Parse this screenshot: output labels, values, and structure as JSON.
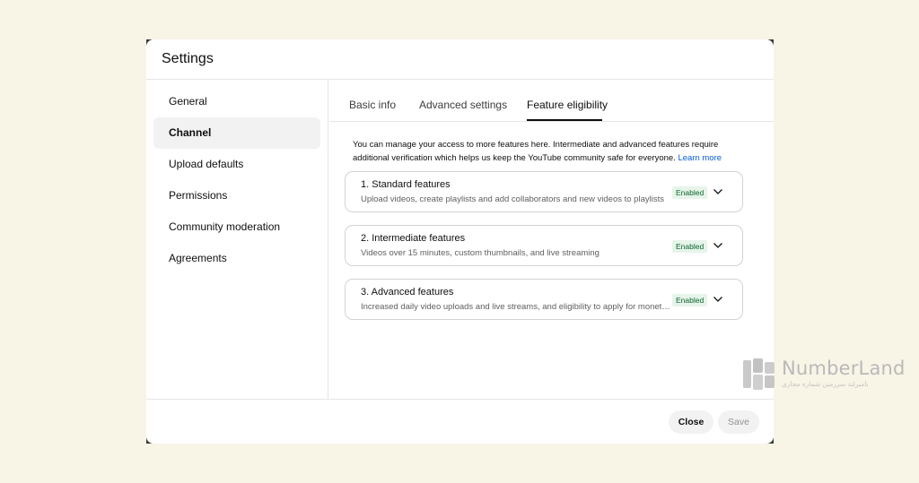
{
  "dialog": {
    "title": "Settings"
  },
  "sidebar": {
    "items": [
      {
        "label": "General"
      },
      {
        "label": "Channel",
        "active": true
      },
      {
        "label": "Upload defaults"
      },
      {
        "label": "Permissions"
      },
      {
        "label": "Community moderation"
      },
      {
        "label": "Agreements"
      }
    ]
  },
  "tabs": [
    {
      "label": "Basic info"
    },
    {
      "label": "Advanced settings"
    },
    {
      "label": "Feature eligibility",
      "active": true
    }
  ],
  "description": {
    "text": "You can manage your access to more features here. Intermediate and advanced features require additional verification which helps us keep the YouTube community safe for everyone.",
    "link": "Learn more"
  },
  "features": [
    {
      "title": "1. Standard features",
      "subtitle": "Upload videos, create playlists and add collaborators and new videos to playlists",
      "status": "Enabled",
      "icon": "chevron-down-icon"
    },
    {
      "title": "2. Intermediate features",
      "subtitle": "Videos over 15 minutes, custom thumbnails, and live streaming",
      "status": "Enabled",
      "icon": "chevron-down-icon"
    },
    {
      "title": "3. Advanced features",
      "subtitle": "Increased daily video uploads and live streams, and eligibility to apply for monetization",
      "status": "Enabled",
      "icon": "chevron-down-icon"
    }
  ],
  "footer": {
    "close_label": "Close",
    "save_label": "Save"
  },
  "watermark": {
    "brand": "NumberLand",
    "tagline": "نامبرلند سرزمین شماره مجازی"
  },
  "colors": {
    "accent_link": "#065fd4",
    "badge_bg": "#e6f4ea",
    "badge_text": "#0d652d"
  }
}
